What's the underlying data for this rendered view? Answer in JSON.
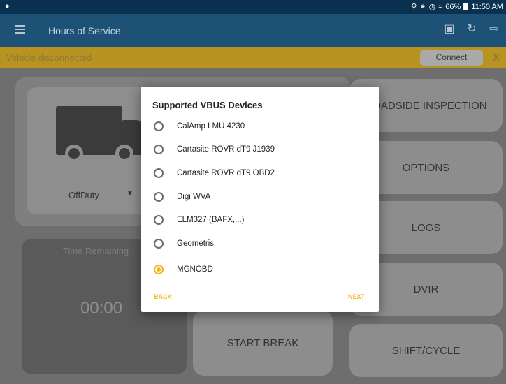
{
  "statusbar": {
    "right_text": "66%",
    "time": "11:50 AM"
  },
  "appbar": {
    "title": "Hours of Service"
  },
  "banner": {
    "text": "Vehicle disconnected",
    "connect_label": "Connect",
    "close_label": "X"
  },
  "duty": {
    "status": "OffDuty"
  },
  "time_remaining": {
    "label": "Time Remaining",
    "value": "00:00"
  },
  "actions": {
    "roadside": "ROADSIDE INSPECTION",
    "options": "OPTIONS",
    "logs": "LOGS",
    "dvir": "DVIR",
    "shift": "SHIFT/CYCLE",
    "start_break": "START BREAK"
  },
  "dialog": {
    "title": "Supported VBUS Devices",
    "options": [
      {
        "label": "CalAmp LMU 4230",
        "selected": false
      },
      {
        "label": "Cartasite ROVR dT9 J1939",
        "selected": false
      },
      {
        "label": "Cartasite ROVR dT9 OBD2",
        "selected": false
      },
      {
        "label": "Digi WVA",
        "selected": false
      },
      {
        "label": "ELM327 (BAFX,...)",
        "selected": false
      },
      {
        "label": "Geometris",
        "selected": false
      },
      {
        "label": "MGNOBD",
        "selected": true
      }
    ],
    "back_label": "BACK",
    "next_label": "NEXT"
  },
  "colors": {
    "appbar": "#1d5276",
    "banner": "#b99322",
    "accent": "#f2b41c"
  }
}
